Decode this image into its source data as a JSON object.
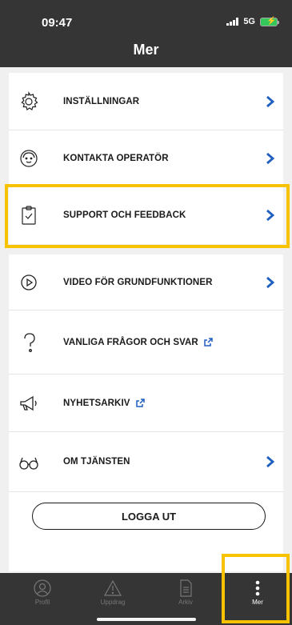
{
  "status_bar": {
    "time": "09:47",
    "network": "5G"
  },
  "header": {
    "title": "Mer"
  },
  "menu_group_1": [
    {
      "label": "INSTÄLLNINGAR",
      "icon": "gear-icon"
    },
    {
      "label": "KONTAKTA OPERATÖR",
      "icon": "operator-face-icon"
    },
    {
      "label": "SUPPORT OCH FEEDBACK",
      "icon": "clipboard-check-icon"
    }
  ],
  "menu_group_2": [
    {
      "label": "VIDEO FÖR GRUNDFUNKTIONER",
      "icon": "play-circle-icon"
    },
    {
      "label": "VANLIGA FRÅGOR OCH SVAR",
      "icon": "question-icon"
    },
    {
      "label": "NYHETSARKIV",
      "icon": "megaphone-icon"
    },
    {
      "label": "OM TJÄNSTEN",
      "icon": "glasses-icon"
    }
  ],
  "logout_label": "LOGGA UT",
  "tabbar": [
    {
      "label": "Profil",
      "icon": "profile-icon"
    },
    {
      "label": "Uppdrag",
      "icon": "warning-icon"
    },
    {
      "label": "Arkiv",
      "icon": "document-icon"
    },
    {
      "label": "Mer",
      "icon": "more-dots-icon"
    }
  ],
  "colors": {
    "header": "#353535",
    "chevron": "#1f5fbf",
    "highlight": "#f7c200"
  }
}
